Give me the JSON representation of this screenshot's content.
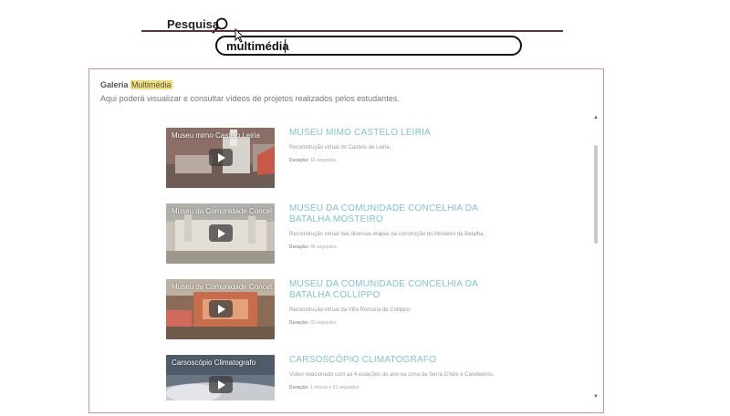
{
  "search": {
    "label": "Pesquisa",
    "value": "multimédia"
  },
  "gallery": {
    "title_prefix": "Galeria",
    "title_highlight": "Multimédia",
    "subtitle": "Aqui poderá visualizar e consultar vídeos de projetos realizados pelos estudantes."
  },
  "videos": [
    {
      "thumb_title": "Museu mimo Castelo Leiria",
      "title": "MUSEU MIMO CASTELO LEIRIA",
      "description": "Reconstrução virtual do Castelo de Leiria.",
      "duration_label": "Duração:",
      "duration": "16 segundos"
    },
    {
      "thumb_title": "Museu da Comunidade Concel...",
      "title": "MUSEU DA COMUNIDADE CONCELHIA DA BATALHA MOSTEIRO",
      "description": "Reconstrução virtual das diversas etapas da construção do Mosteiro da Batalha.",
      "duration_label": "Duração:",
      "duration": "46 segundos"
    },
    {
      "thumb_title": "Museu da Comunidade Concel...",
      "title": "MUSEU DA COMUNIDADE CONCELHIA DA BATALHA COLLIPPO",
      "description": "Reconstrução virtual da Villa Romana de Collippo.",
      "duration_label": "Duração:",
      "duration": "33 segundos"
    },
    {
      "thumb_title": "Carsoscópio Climatografo",
      "title": "CARSOSCÓPIO CLIMATOGRAFO",
      "description": "Vídeo relacionado com as 4 estações do ano na zona da Serra D'Aire e Candeeiros.",
      "duration_label": "Duração:",
      "duration": "1 minuto e 21 segundos"
    }
  ]
}
